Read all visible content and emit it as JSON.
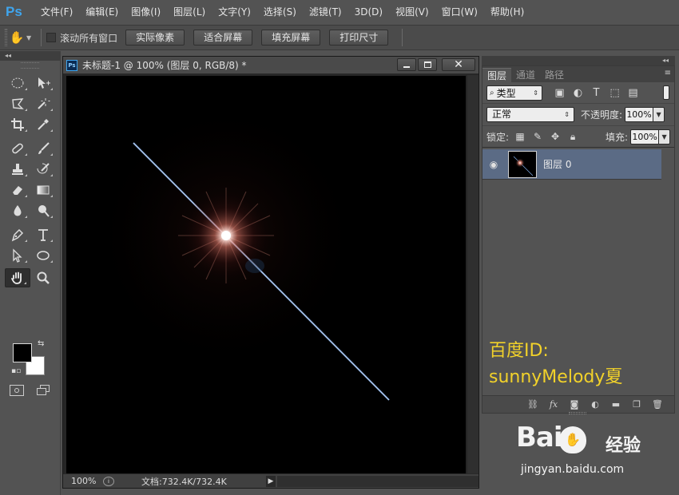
{
  "app": {
    "logo": "Ps"
  },
  "menu": [
    "文件(F)",
    "编辑(E)",
    "图像(I)",
    "图层(L)",
    "文字(Y)",
    "选择(S)",
    "滤镜(T)",
    "3D(D)",
    "视图(V)",
    "窗口(W)",
    "帮助(H)"
  ],
  "options": {
    "scroll_all_label": "滚动所有窗口",
    "buttons": [
      "实际像素",
      "适合屏幕",
      "填充屏幕",
      "打印尺寸"
    ]
  },
  "document": {
    "icon_text": "Ps",
    "title": "未标题-1 @ 100% (图层 0, RGB/8) *",
    "close_glyph": "✕",
    "zoom": "100%",
    "doc_size": "文档:732.4K/732.4K",
    "status_arrow": "▶"
  },
  "panel": {
    "collapse_glyph": "◂◂",
    "tabs": [
      "图层",
      "通道",
      "路径"
    ],
    "filter_kind": "类型",
    "blend_mode": "正常",
    "opacity_label": "不透明度:",
    "opacity_value": "100%",
    "lock_label": "锁定:",
    "fill_label": "填充:",
    "fill_value": "100%",
    "layer_name": "图层 0"
  },
  "watermark": {
    "line1": "百度ID:",
    "line2": "sunnyMelody夏"
  },
  "site": {
    "brand": "Bai",
    "brand_cn": "经验",
    "url": "jingyan.baidu.com"
  },
  "colors": {
    "foreground": "#000000",
    "background": "#ffffff",
    "accent": "#3fa5ee",
    "selected_layer": "#5b6b85",
    "watermark_yellow": "#f2d22a"
  }
}
